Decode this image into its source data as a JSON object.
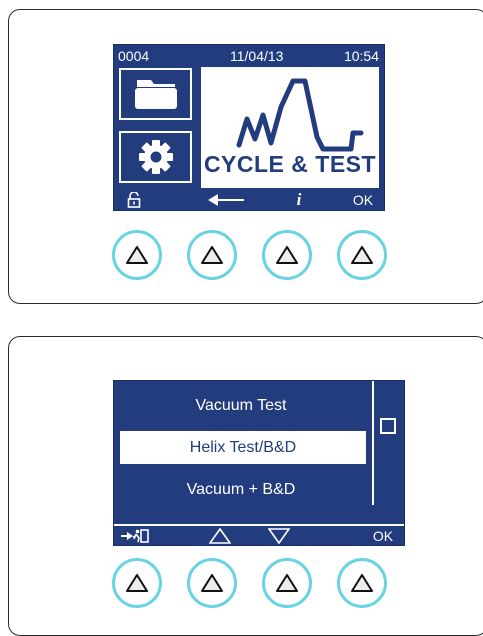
{
  "panel1": {
    "status": {
      "counter": "0004",
      "date": "11/04/13",
      "time": "10:54"
    },
    "logo_text": "CYCLE & TEST",
    "softkeys": {
      "info": "i",
      "ok": "OK"
    },
    "icons": [
      "folder-icon",
      "gear-icon",
      "unlock-icon",
      "back-arrow-icon",
      "info-icon"
    ]
  },
  "panel2": {
    "menu_items": [
      "Vacuum Test",
      "Helix Test/B&D",
      "Vacuum + B&D"
    ],
    "selected_index": 1,
    "softkeys": {
      "ok": "OK"
    },
    "icons": [
      "exit-icon",
      "up-triangle-icon",
      "down-triangle-icon"
    ]
  },
  "colors": {
    "screen": "#223c7e",
    "button_ring": "#67d3e3",
    "panel_border": "#2b2b2b"
  },
  "hardware_buttons": [
    "up-triangle-icon",
    "up-triangle-icon",
    "up-triangle-icon",
    "up-triangle-icon"
  ]
}
